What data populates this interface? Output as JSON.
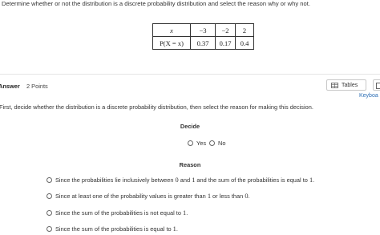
{
  "question": "Determine whether or not the distribution is a discrete probability distribution and select the reason why or why not.",
  "table": {
    "row1": {
      "header": "x",
      "values": [
        "−3",
        "−2",
        "2"
      ]
    },
    "row2": {
      "header": "P(X = x)",
      "values": [
        "0.37",
        "0.17",
        "0.4"
      ]
    }
  },
  "answer": {
    "label": "Answer",
    "points": "2 Points"
  },
  "toolbar": {
    "tables_label": "Tables",
    "keyboard_label": "Keyboa"
  },
  "instructions": "First, decide whether the distribution is a discrete probability distribution, then select the reason for making this decision.",
  "decide": {
    "heading": "Decide",
    "yes": "Yes",
    "no": "No"
  },
  "reason": {
    "heading": "Reason",
    "options": [
      [
        "Since the probabilities lie inclusively between ",
        "0",
        " and ",
        "1",
        " and the sum of the probabilities is equal to ",
        "1",
        "."
      ],
      [
        "Since at least one of the probability values is greater than ",
        "1",
        " or less than ",
        "0",
        "."
      ],
      [
        "Since the sum of the probabilities is not equal to ",
        "1",
        "."
      ],
      [
        "Since the sum of the probabilities is equal to ",
        "1",
        "."
      ]
    ]
  }
}
